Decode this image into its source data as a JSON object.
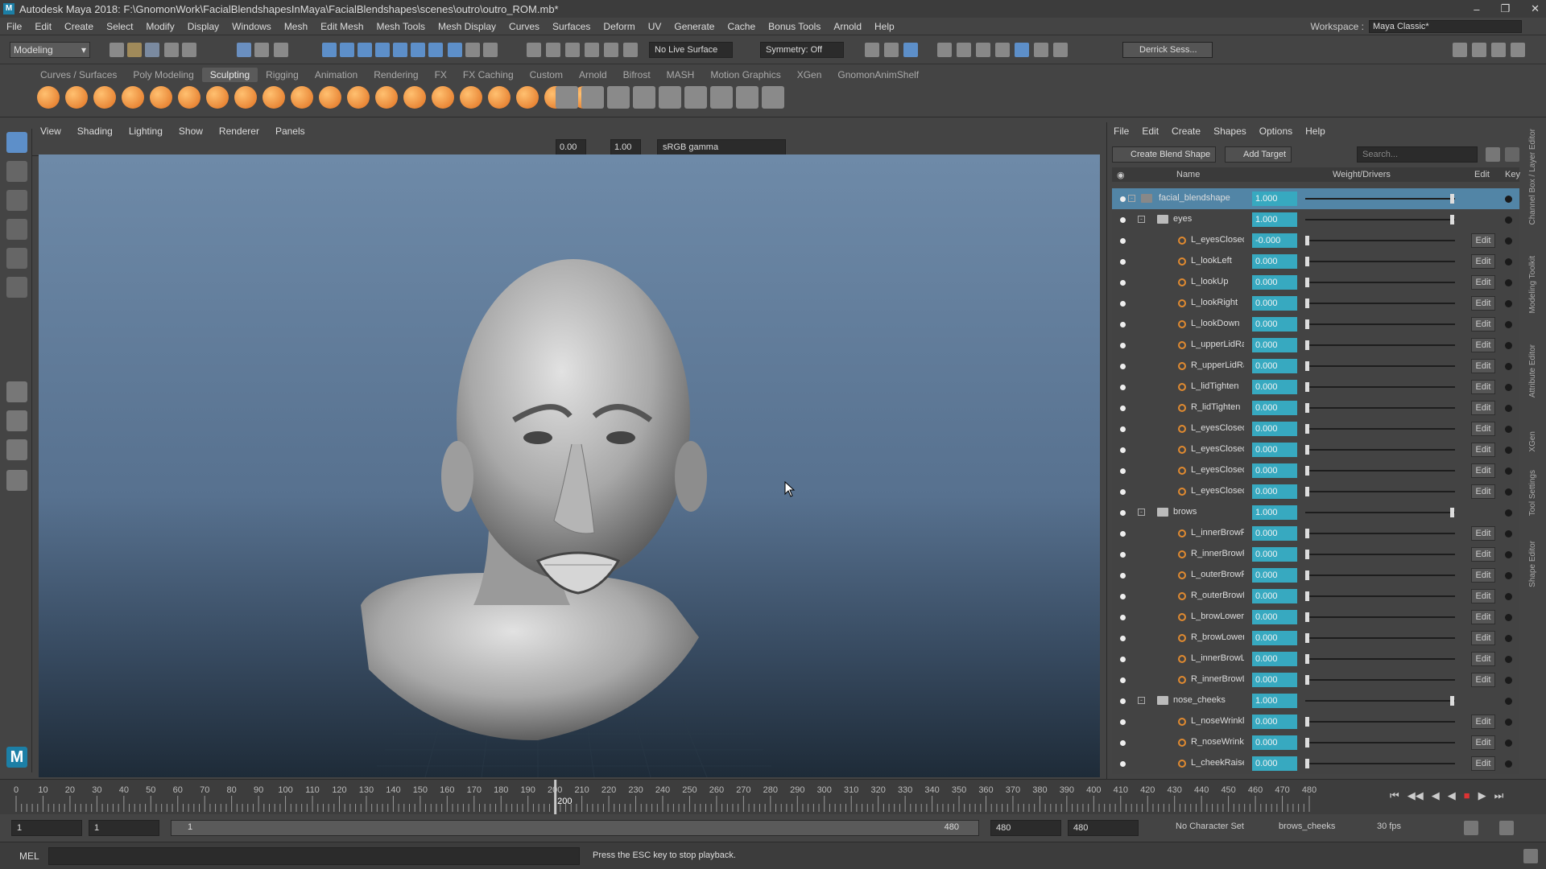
{
  "window": {
    "title": "Autodesk Maya 2018: F:\\GnomonWork\\FacialBlendshapesInMaya\\FacialBlendshapes\\scenes\\outro\\outro_ROM.mb*"
  },
  "menu": [
    "File",
    "Edit",
    "Create",
    "Select",
    "Modify",
    "Display",
    "Windows",
    "Mesh",
    "Edit Mesh",
    "Mesh Tools",
    "Mesh Display",
    "Curves",
    "Surfaces",
    "Deform",
    "UV",
    "Generate",
    "Cache",
    "Bonus Tools",
    "Arnold",
    "Help"
  ],
  "workspace": {
    "label": "Workspace :",
    "value": "Maya Classic*"
  },
  "status": {
    "mode": "Modeling",
    "live_surface": "No Live Surface",
    "symmetry": "Symmetry: Off",
    "user": "Derrick Sess..."
  },
  "shelf_tabs": [
    "Curves / Surfaces",
    "Poly Modeling",
    "Sculpting",
    "Rigging",
    "Animation",
    "Rendering",
    "FX",
    "FX Caching",
    "Custom",
    "Arnold",
    "Bifrost",
    "MASH",
    "Motion Graphics",
    "XGen",
    "GnomonAnimShelf"
  ],
  "viewport": {
    "menu": [
      "View",
      "Shading",
      "Lighting",
      "Show",
      "Renderer",
      "Panels"
    ],
    "exposure": "0.00",
    "gamma": "1.00",
    "colorspace": "sRGB gamma"
  },
  "shape_editor": {
    "menu": [
      "File",
      "Edit",
      "Create",
      "Shapes",
      "Options",
      "Help"
    ],
    "create_blend": "Create Blend Shape",
    "add_target": "Add Target",
    "search_placeholder": "Search...",
    "headers": {
      "name": "Name",
      "weight": "Weight/Drivers",
      "edit": "Edit",
      "key": "Key"
    },
    "edit_label": "Edit",
    "rows": [
      {
        "name": "facial_blendshape",
        "value": "1.000",
        "type": "node",
        "knob": 1
      },
      {
        "name": "eyes",
        "value": "1.000",
        "type": "group",
        "knob": 1
      },
      {
        "name": "L_eyesClosed",
        "value": "-0.000",
        "type": "target",
        "knob": 0
      },
      {
        "name": "L_lookLeft",
        "value": "0.000",
        "type": "target",
        "knob": 0
      },
      {
        "name": "L_lookUp",
        "value": "0.000",
        "type": "target",
        "knob": 0
      },
      {
        "name": "L_lookRight",
        "value": "0.000",
        "type": "target",
        "knob": 0
      },
      {
        "name": "L_lookDown",
        "value": "0.000",
        "type": "target",
        "knob": 0
      },
      {
        "name": "L_upperLidRaise",
        "value": "0.000",
        "type": "target",
        "knob": 0
      },
      {
        "name": "R_upperLidRaise",
        "value": "0.000",
        "type": "target",
        "knob": 0
      },
      {
        "name": "L_lidTighten",
        "value": "0.000",
        "type": "target",
        "knob": 0
      },
      {
        "name": "R_lidTighten",
        "value": "0.000",
        "type": "target",
        "knob": 0
      },
      {
        "name": "L_eyesClosed",
        "value": "0.000",
        "type": "target",
        "knob": 0
      },
      {
        "name": "L_eyesClosed",
        "value": "0.000",
        "type": "target",
        "knob": 0
      },
      {
        "name": "L_eyesClosed",
        "value": "0.000",
        "type": "target",
        "knob": 0
      },
      {
        "name": "L_eyesClosed",
        "value": "0.000",
        "type": "target",
        "knob": 0
      },
      {
        "name": "brows",
        "value": "1.000",
        "type": "group",
        "knob": 1
      },
      {
        "name": "L_innerBrowRaise",
        "value": "0.000",
        "type": "target",
        "knob": 0
      },
      {
        "name": "R_innerBrowRaise",
        "value": "0.000",
        "type": "target",
        "knob": 0
      },
      {
        "name": "L_outerBrowRaise",
        "value": "0.000",
        "type": "target",
        "knob": 0
      },
      {
        "name": "R_outerBrowRaise",
        "value": "0.000",
        "type": "target",
        "knob": 0
      },
      {
        "name": "L_browLower",
        "value": "0.000",
        "type": "target",
        "knob": 0
      },
      {
        "name": "R_browLower",
        "value": "0.000",
        "type": "target",
        "knob": 0
      },
      {
        "name": "L_innerBrowLower",
        "value": "0.000",
        "type": "target",
        "knob": 0
      },
      {
        "name": "R_innerBrowLower",
        "value": "0.000",
        "type": "target",
        "knob": 0
      },
      {
        "name": "nose_cheeks",
        "value": "1.000",
        "type": "group",
        "knob": 1
      },
      {
        "name": "L_noseWrinkle",
        "value": "0.000",
        "type": "target",
        "knob": 0
      },
      {
        "name": "R_noseWrinkle",
        "value": "0.000",
        "type": "target",
        "knob": 0
      },
      {
        "name": "L_cheekRaise",
        "value": "0.000",
        "type": "target",
        "knob": 0
      }
    ]
  },
  "side_tabs": [
    "Channel Box / Layer Editor",
    "Modeling Toolkit",
    "Attribute Editor",
    "XGen",
    "Tool Settings",
    "Shape Editor"
  ],
  "timeline": {
    "ticks": [
      "0",
      "10",
      "20",
      "30",
      "40",
      "50",
      "60",
      "70",
      "80",
      "90",
      "100",
      "110",
      "120",
      "130",
      "140",
      "150",
      "160",
      "170",
      "180",
      "190",
      "200",
      "210",
      "220",
      "230",
      "240",
      "250",
      "260",
      "270",
      "280",
      "290",
      "300",
      "310",
      "320",
      "330",
      "340",
      "350",
      "360",
      "370",
      "380",
      "390",
      "400",
      "410",
      "420",
      "430",
      "440",
      "450",
      "460",
      "470",
      "480"
    ],
    "current": "200"
  },
  "range": {
    "start": "1",
    "playback_start": "1",
    "slider_start": "1",
    "slider_end": "480",
    "playback_end": "480",
    "end": "480",
    "character_set": "No Character Set",
    "anim_layer": "brows_cheeks",
    "fps": "30 fps"
  },
  "command": {
    "lang": "MEL",
    "help": "Press the ESC key to stop playback."
  }
}
